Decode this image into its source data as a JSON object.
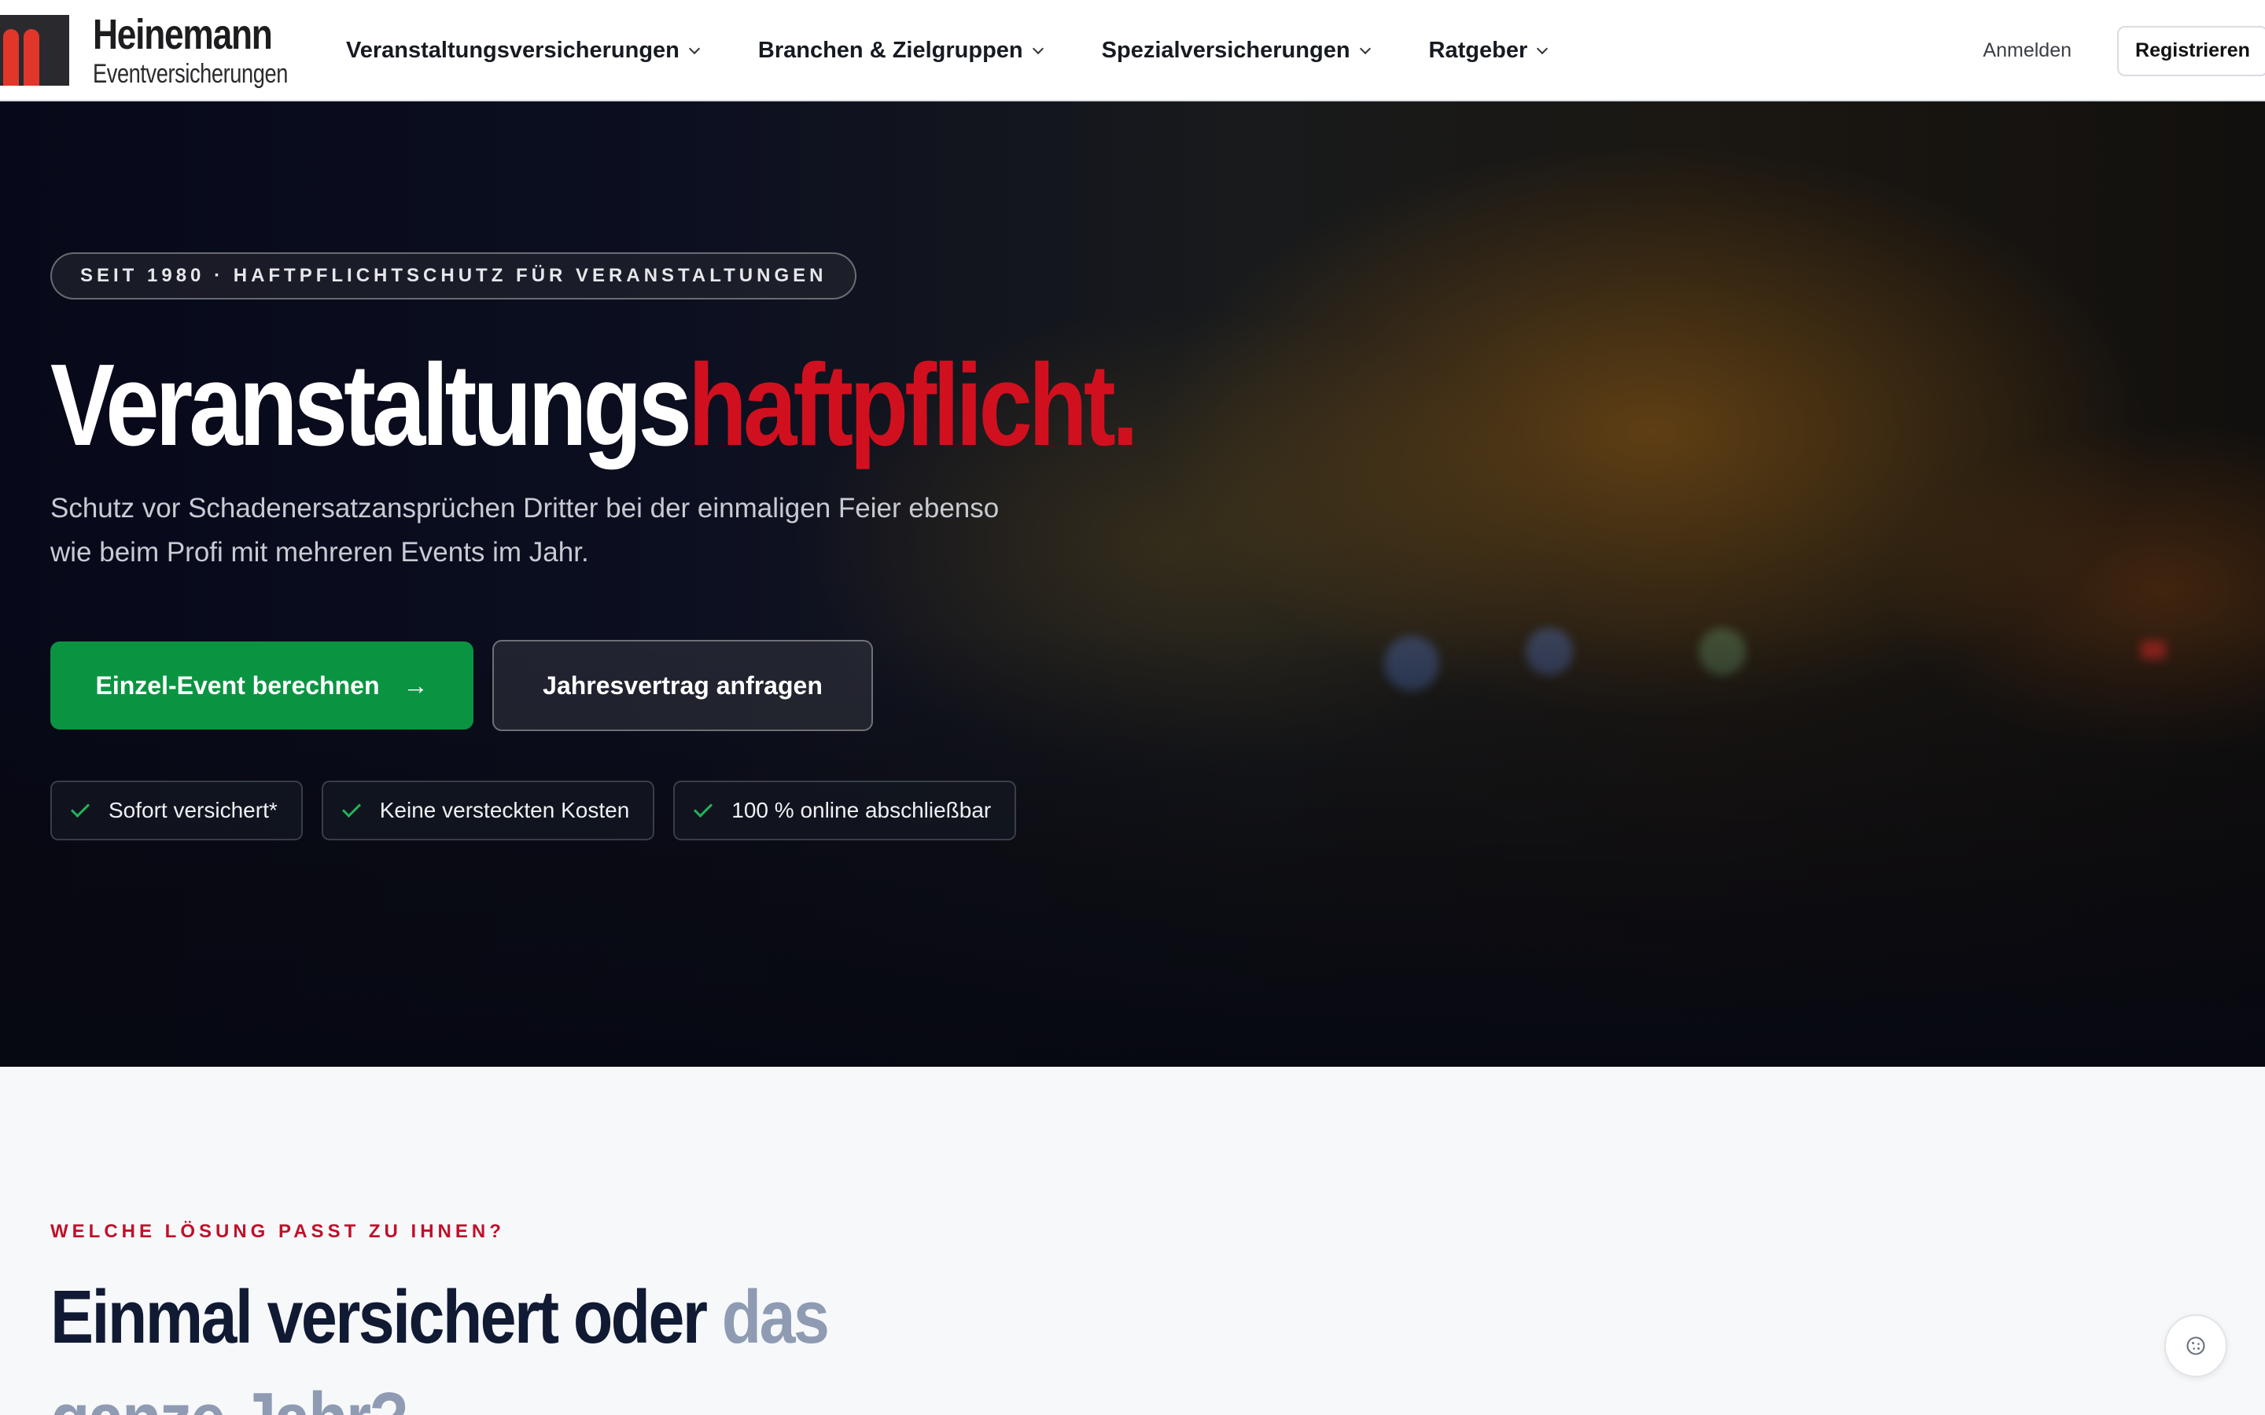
{
  "brand": {
    "name": "Heinemann",
    "tagline": "Eventversicherungen",
    "logo_color": "#e2362b"
  },
  "nav": {
    "items": [
      {
        "label": "Veranstaltungsversicherungen"
      },
      {
        "label": "Branchen & Zielgruppen"
      },
      {
        "label": "Spezialversicherungen"
      },
      {
        "label": "Ratgeber"
      }
    ],
    "login_label": "Anmelden",
    "register_label": "Registrieren"
  },
  "hero": {
    "tag": "SEIT 1980 · HAFTPFLICHTSCHUTZ FÜR VERANSTALTUNGEN",
    "title_main": "Veranstaltungs",
    "title_accent": "haftpflicht.",
    "subtitle": "Schutz vor Schadenersatzansprüchen Dritter bei der einmaligen Feier ebenso wie beim Profi mit mehreren Events im Jahr.",
    "primary_cta": "Einzel-Event berechnen",
    "secondary_cta": "Jahresvertrag anfragen",
    "features": [
      {
        "label": "Sofort versichert*"
      },
      {
        "label": "Keine versteckten Kosten"
      },
      {
        "label": "100 % online abschließbar"
      }
    ]
  },
  "section": {
    "eyebrow": "WELCHE LÖSUNG PASST ZU IHNEN?",
    "title_main": "Einmal versichert oder ",
    "title_muted": "das ganze Jahr?"
  },
  "colors": {
    "accent_red": "#d0101f",
    "cta_green": "#0a9441",
    "check_green": "#22b35a",
    "heading_navy": "#101a33"
  }
}
